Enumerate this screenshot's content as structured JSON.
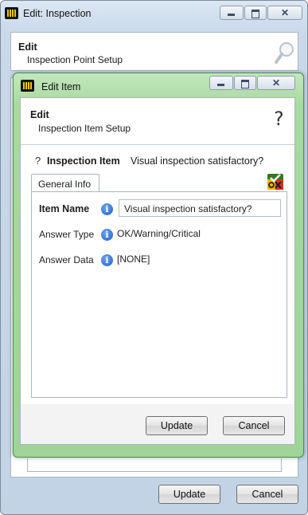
{
  "outer": {
    "title": "Edit: Inspection",
    "header_title": "Edit",
    "header_subtitle": "Inspection Point Setup",
    "update_label": "Update",
    "cancel_label": "Cancel"
  },
  "inner": {
    "title": "Edit Item",
    "header_title": "Edit",
    "header_subtitle": "Inspection Item Setup",
    "help_glyph": "?",
    "item_prefix": "?",
    "item_heading": "Inspection Item",
    "item_value": "Visual inspection satisfactory?",
    "tab_general": "General Info",
    "fields": {
      "item_name_label": "Item Name",
      "item_name_value": "Visual inspection satisfactory?",
      "answer_type_label": "Answer Type",
      "answer_type_value": "OK/Warning/Critical",
      "answer_data_label": "Answer Data",
      "answer_data_value": "[NONE]"
    },
    "update_label": "Update",
    "cancel_label": "Cancel"
  },
  "icons": {
    "app": "app-logo-icon",
    "search": "search-icon",
    "help": "help-icon",
    "info": "info-icon",
    "status": "ok-warning-critical-icon"
  },
  "colors": {
    "outer_frame": "#c9d9ea",
    "inner_frame": "#a8d9a0",
    "info_blue": "#1f5fc8"
  }
}
